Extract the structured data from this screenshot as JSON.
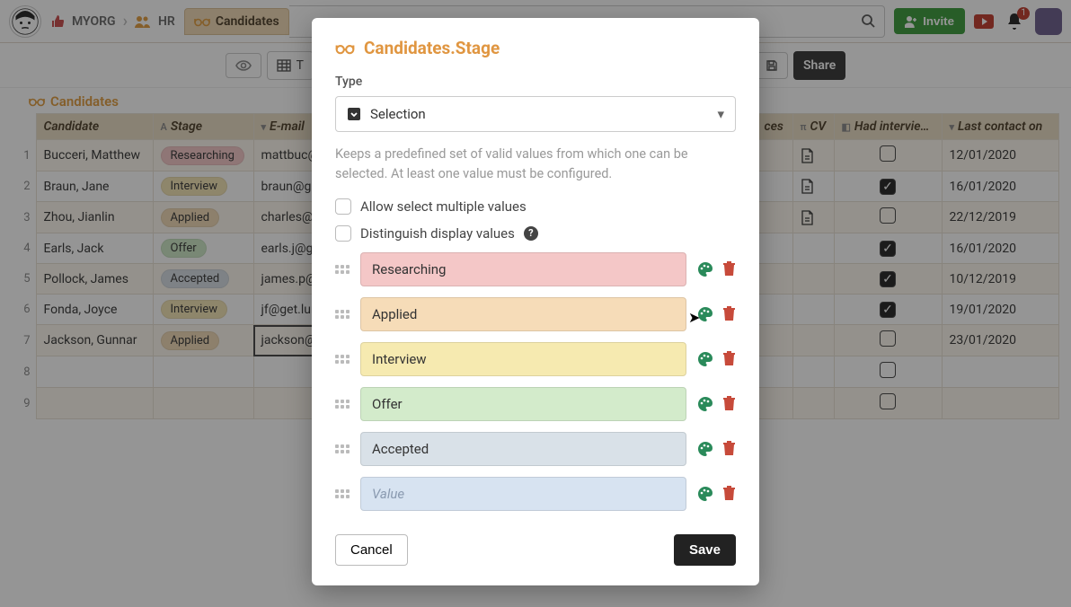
{
  "breadcrumb": {
    "org": "MYORG",
    "section": "HR"
  },
  "tab": {
    "label": "Candidates"
  },
  "header": {
    "invite_label": "Invite",
    "notification_count": "1"
  },
  "toolbar": {
    "share_label": "Share"
  },
  "table": {
    "title": "Candidates",
    "columns": {
      "candidate": "Candidate",
      "stage": "Stage",
      "email": "E-mail",
      "ces": "ces",
      "cv": "CV",
      "had_interview": "Had interview?",
      "last_contact": "Last contact on"
    },
    "rows": [
      {
        "n": "1",
        "candidate": "Bucceri, Matthew",
        "stage": "Researching",
        "email": "mattbuc@",
        "cv": true,
        "had": false,
        "last": "12/01/2020"
      },
      {
        "n": "2",
        "candidate": "Braun, Jane",
        "stage": "Interview",
        "email": "braun@ge",
        "cv": true,
        "had": true,
        "last": "16/01/2020"
      },
      {
        "n": "3",
        "candidate": "Zhou, Jianlin",
        "stage": "Applied",
        "email": "charles@",
        "cv": true,
        "had": false,
        "last": "22/12/2019"
      },
      {
        "n": "4",
        "candidate": "Earls, Jack",
        "stage": "Offer",
        "email": "earls.j@ge",
        "cv": false,
        "had": true,
        "last": "16/01/2020"
      },
      {
        "n": "5",
        "candidate": "Pollock, James",
        "stage": "Accepted",
        "email": "james.p@",
        "cv": false,
        "had": true,
        "last": "10/12/2019"
      },
      {
        "n": "6",
        "candidate": "Fonda, Joyce",
        "stage": "Interview",
        "email": "jf@get.lun",
        "cv": false,
        "had": true,
        "last": "19/01/2020"
      },
      {
        "n": "7",
        "candidate": "Jackson, Gunnar",
        "stage": "Applied",
        "email": "jackson@",
        "cv": false,
        "had": false,
        "last": "23/01/2020"
      }
    ]
  },
  "modal": {
    "title": "Candidates.Stage",
    "type_label": "Type",
    "type_value": "Selection",
    "help_text": "Keeps a predefined set of valid values from which one can be selected. At least one value must be configured.",
    "opt_multiple": "Allow select multiple values",
    "opt_distinguish": "Distinguish display values",
    "values": [
      {
        "label": "Researching",
        "cls": "Researching"
      },
      {
        "label": "Applied",
        "cls": "Applied"
      },
      {
        "label": "Interview",
        "cls": "Interview"
      },
      {
        "label": "Offer",
        "cls": "Offer"
      },
      {
        "label": "Accepted",
        "cls": "Accepted"
      }
    ],
    "new_placeholder": "Value",
    "cancel_label": "Cancel",
    "save_label": "Save"
  }
}
